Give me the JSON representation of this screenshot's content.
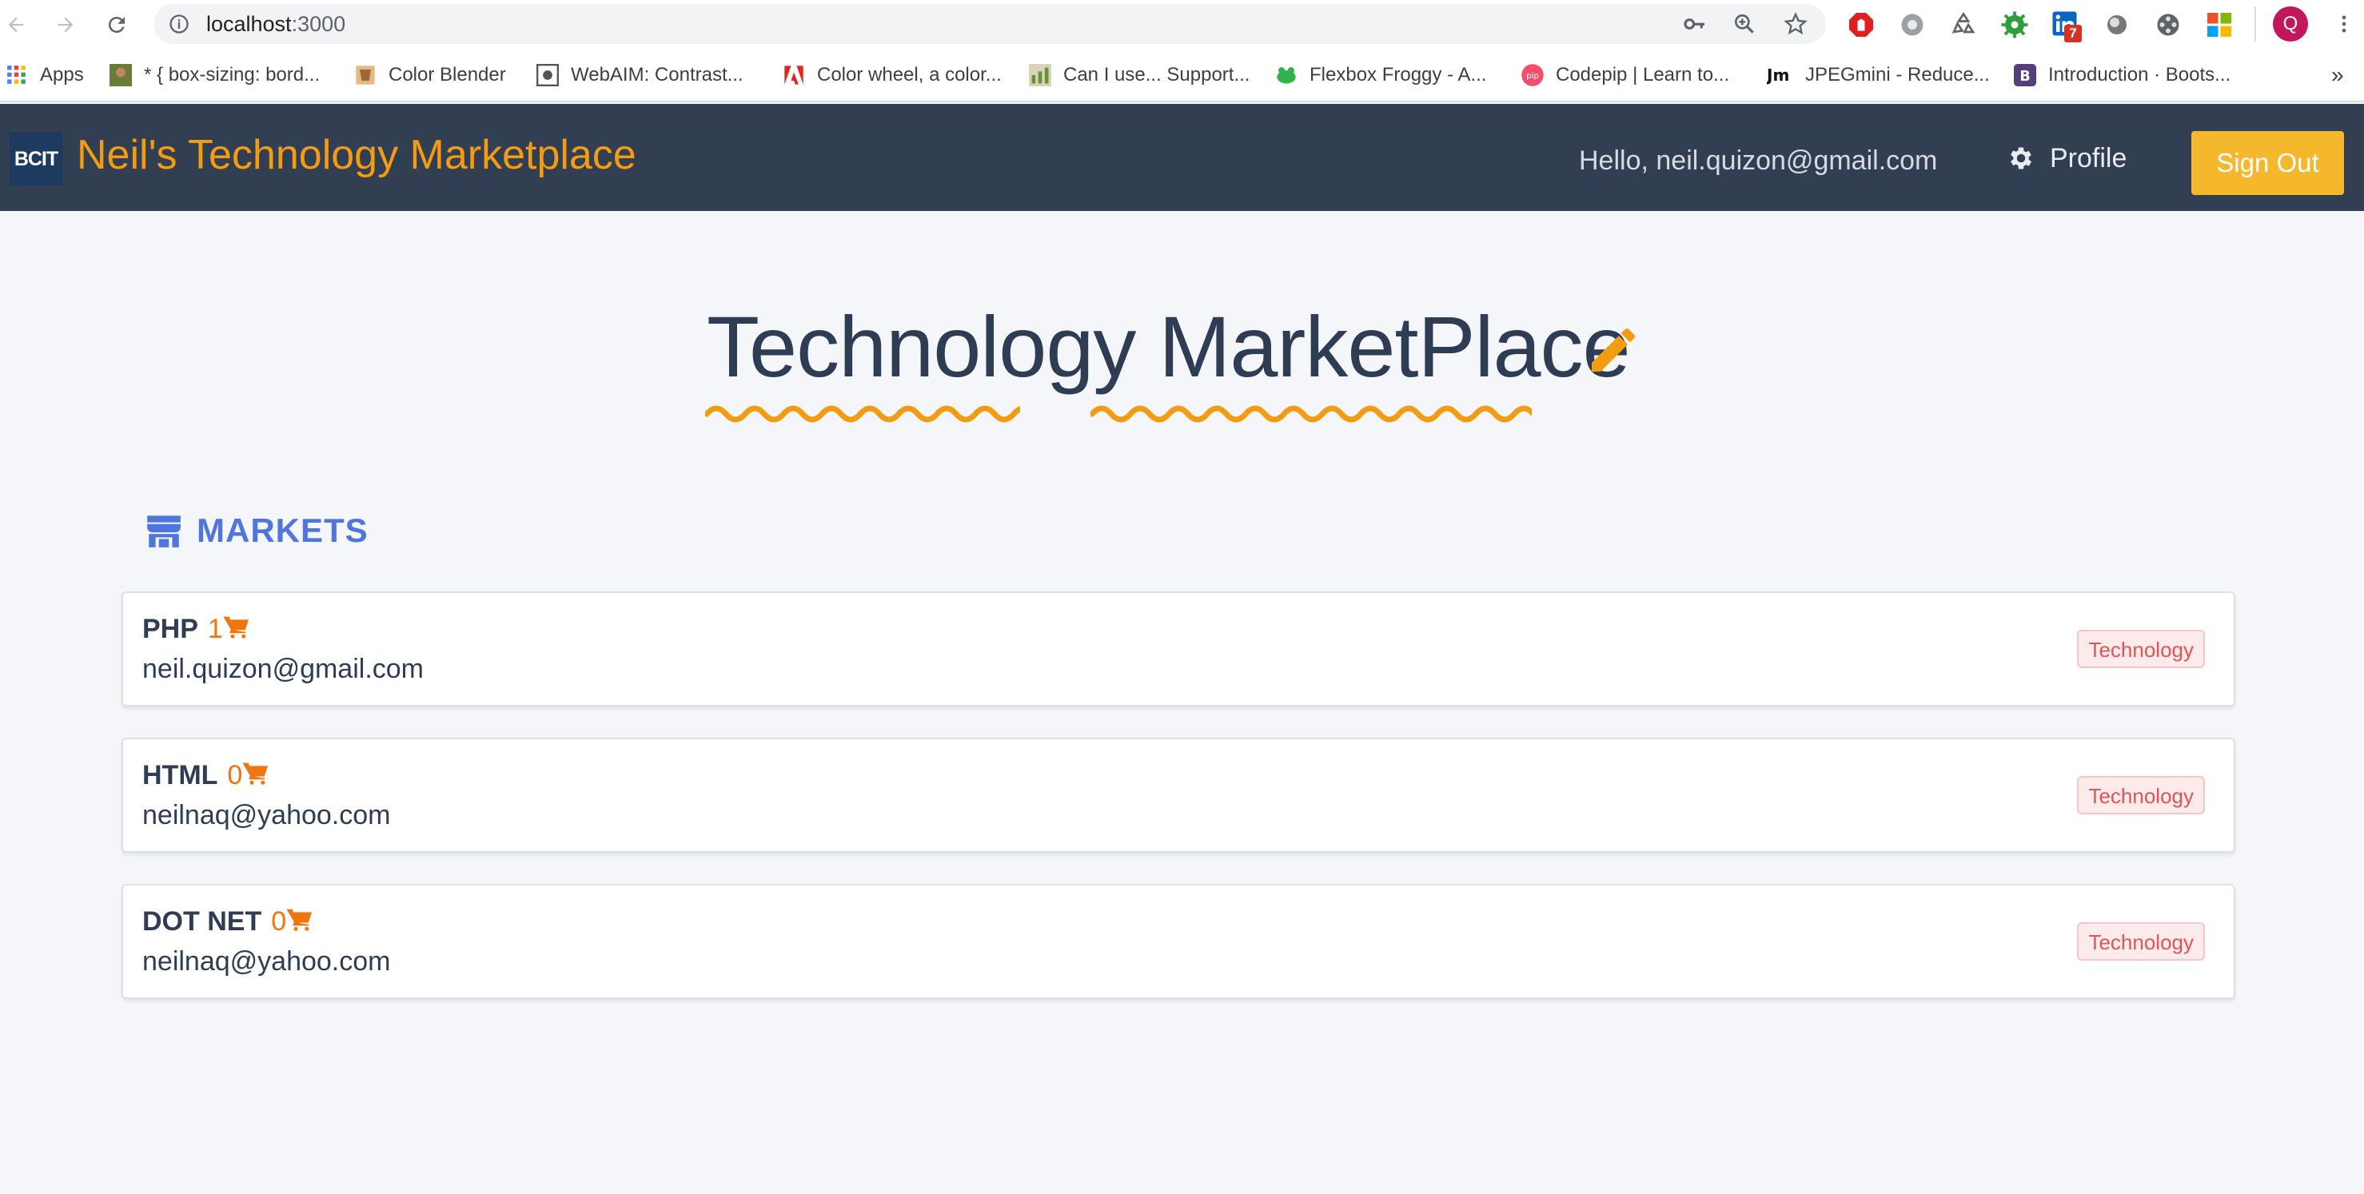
{
  "browser": {
    "url_host": "localhost",
    "url_port": ":3000",
    "extensions": [
      "key-icon",
      "zoom-icon",
      "star-icon",
      "adblock-icon",
      "settings-icon",
      "recycle-icon",
      "gear-green-icon",
      "linkedin-icon",
      "circle-icon",
      "film-icon",
      "windows-icon",
      "avatar-q"
    ],
    "linkedin_badge": "7",
    "avatar_letter": "Q",
    "bookmarks": [
      {
        "label": "Apps"
      },
      {
        "label": "* { box-sizing: bord..."
      },
      {
        "label": "Color Blender"
      },
      {
        "label": "WebAIM: Contrast..."
      },
      {
        "label": "Color wheel, a color..."
      },
      {
        "label": "Can I use... Support..."
      },
      {
        "label": "Flexbox Froggy - A..."
      },
      {
        "label": "Codepip | Learn to..."
      },
      {
        "label": "JPEGmini - Reduce..."
      },
      {
        "label": "Introduction · Boots..."
      }
    ],
    "bookmarks_overflow": "»"
  },
  "navbar": {
    "logo_text": "BCIT",
    "title": "Neil's Technology Marketplace",
    "greeting": "Hello, neil.quizon@gmail.com",
    "profile_label": "Profile",
    "signout_label": "Sign Out"
  },
  "main": {
    "heading": "Technology MarketPlace",
    "section_label": "MARKETS",
    "markets": [
      {
        "name": "PHP",
        "count": "1",
        "owner": "neil.quizon@gmail.com",
        "tag": "Technology"
      },
      {
        "name": "HTML",
        "count": "0",
        "owner": "neilnaq@yahoo.com",
        "tag": "Technology"
      },
      {
        "name": "DOT NET",
        "count": "0",
        "owner": "neilnaq@yahoo.com",
        "tag": "Technology"
      }
    ]
  },
  "colors": {
    "navbar_bg": "#323e52",
    "brand_orange": "#f39c12",
    "signout_yellow": "#f5b72c",
    "markets_blue": "#5076dd",
    "tag_red": "#e05555"
  }
}
